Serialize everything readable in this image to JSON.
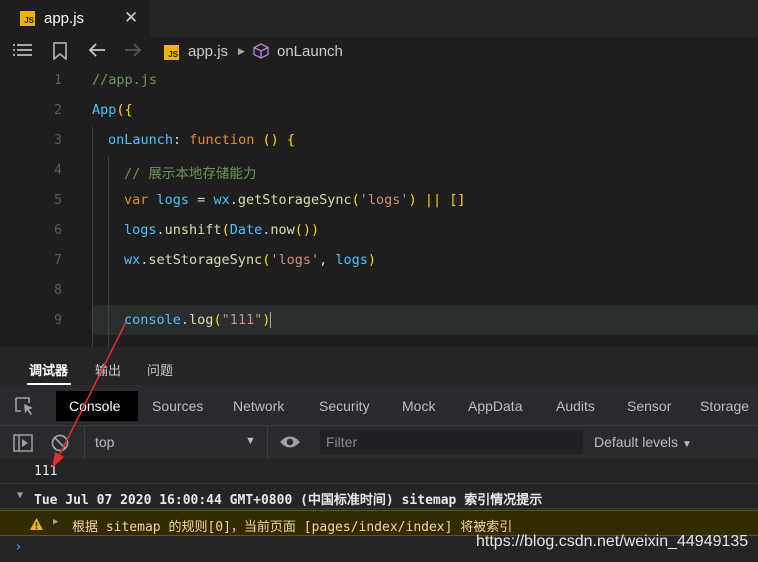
{
  "tab": {
    "badge": "JS",
    "title": "app.js",
    "close": "✕"
  },
  "breadcrumb": {
    "file": "app.js",
    "function": "onLaunch"
  },
  "code_lines": [
    {
      "n": "1",
      "text": "//app.js"
    },
    {
      "n": "2",
      "text": "App({"
    },
    {
      "n": "3",
      "text": "onLaunch: function () {"
    },
    {
      "n": "4",
      "text": "// 展示本地存储能力"
    },
    {
      "n": "5",
      "text": "var logs = wx.getStorageSync('logs') || []"
    },
    {
      "n": "6",
      "text": "logs.unshift(Date.now())"
    },
    {
      "n": "7",
      "text": "wx.setStorageSync('logs', logs)"
    },
    {
      "n": "8",
      "text": ""
    },
    {
      "n": "9",
      "text": "console.log(\"111\")"
    }
  ],
  "panel_tabs": [
    "调试器",
    "输出",
    "问题"
  ],
  "devtools_tabs": [
    "Console",
    "Sources",
    "Network",
    "Security",
    "Mock",
    "AppData",
    "Audits",
    "Sensor",
    "Storage"
  ],
  "console_toolbar": {
    "context": "top",
    "filter_placeholder": "Filter",
    "levels": "Default levels"
  },
  "console": {
    "log_output": "111",
    "group_header": "Tue Jul 07 2020 16:00:44 GMT+0800 (中国标准时间) sitemap 索引情况提示",
    "warning": "根据 sitemap 的规则[0]，当前页面 [pages/index/index] 将被索引"
  },
  "watermark": "https://blog.csdn.net/weixin_44949135",
  "colors": {
    "warning_bg": "#332b00",
    "warning_icon": "#f0b400",
    "annotation_arrow": "#e0302b",
    "prompt": "#4aa0f0"
  }
}
